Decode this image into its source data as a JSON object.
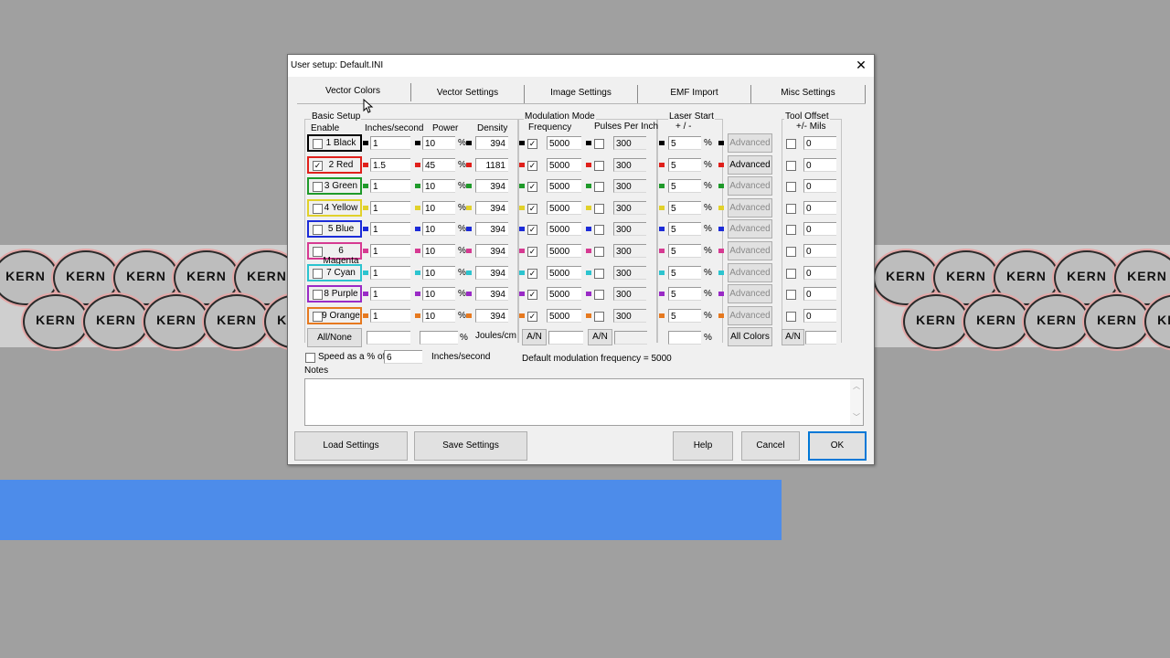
{
  "dialog": {
    "title": "User setup: Default.INI",
    "close_glyph": "✕",
    "tabs": [
      "Vector Colors",
      "Vector Settings",
      "Image Settings",
      "EMF Import",
      "Misc Settings"
    ],
    "active_tab": "Vector Colors"
  },
  "headers": {
    "basic_setup": "Basic Setup",
    "enable": "Enable",
    "speed": "Inches/second",
    "power": "Power",
    "density": "Density",
    "modulation_mode": "Modulation Mode",
    "frequency": "Frequency",
    "pulses_per_inch": "Pulses Per Inch",
    "laser_start": "Laser Start",
    "plus_minus": "+ / -",
    "tool_offset": "Tool Offset",
    "mils": "+/- Mils"
  },
  "rows": [
    {
      "label": "1 Black",
      "color": "#000000",
      "checked": false,
      "speed": "1",
      "power": "10",
      "density": "394",
      "mod": true,
      "freq": "5000",
      "ppi_on": false,
      "ppi": "300",
      "laser": "5",
      "advanced_enabled": false,
      "offset_on": false,
      "offset": "0"
    },
    {
      "label": "2 Red",
      "color": "#e0201b",
      "checked": true,
      "speed": "1.5",
      "power": "45",
      "density": "1181",
      "mod": true,
      "freq": "5000",
      "ppi_on": false,
      "ppi": "300",
      "laser": "5",
      "advanced_enabled": true,
      "offset_on": false,
      "offset": "0"
    },
    {
      "label": "3 Green",
      "color": "#1f9a2a",
      "checked": false,
      "speed": "1",
      "power": "10",
      "density": "394",
      "mod": true,
      "freq": "5000",
      "ppi_on": false,
      "ppi": "300",
      "laser": "5",
      "advanced_enabled": false,
      "offset_on": false,
      "offset": "0"
    },
    {
      "label": "4 Yellow",
      "color": "#e1d12a",
      "checked": false,
      "speed": "1",
      "power": "10",
      "density": "394",
      "mod": true,
      "freq": "5000",
      "ppi_on": false,
      "ppi": "300",
      "laser": "5",
      "advanced_enabled": false,
      "offset_on": false,
      "offset": "0"
    },
    {
      "label": "5 Blue",
      "color": "#1c2bd8",
      "checked": false,
      "speed": "1",
      "power": "10",
      "density": "394",
      "mod": true,
      "freq": "5000",
      "ppi_on": false,
      "ppi": "300",
      "laser": "5",
      "advanced_enabled": false,
      "offset_on": false,
      "offset": "0"
    },
    {
      "label": "6 Magenta",
      "color": "#d63a92",
      "checked": false,
      "speed": "1",
      "power": "10",
      "density": "394",
      "mod": true,
      "freq": "5000",
      "ppi_on": false,
      "ppi": "300",
      "laser": "5",
      "advanced_enabled": false,
      "offset_on": false,
      "offset": "0"
    },
    {
      "label": "7 Cyan",
      "color": "#2cc4cf",
      "checked": false,
      "speed": "1",
      "power": "10",
      "density": "394",
      "mod": true,
      "freq": "5000",
      "ppi_on": false,
      "ppi": "300",
      "laser": "5",
      "advanced_enabled": false,
      "offset_on": false,
      "offset": "0"
    },
    {
      "label": "8 Purple",
      "color": "#9a2bc6",
      "checked": false,
      "speed": "1",
      "power": "10",
      "density": "394",
      "mod": true,
      "freq": "5000",
      "ppi_on": false,
      "ppi": "300",
      "laser": "5",
      "advanced_enabled": false,
      "offset_on": false,
      "offset": "0"
    },
    {
      "label": "9 Orange",
      "color": "#e6791f",
      "checked": false,
      "speed": "1",
      "power": "10",
      "density": "394",
      "mod": true,
      "freq": "5000",
      "ppi_on": false,
      "ppi": "300",
      "laser": "5",
      "advanced_enabled": false,
      "offset_on": false,
      "offset": "0"
    }
  ],
  "advanced_label": "Advanced",
  "percent": "%",
  "bottom_row": {
    "all_none": "All/None",
    "joules": "Joules/cm",
    "an": "A/N",
    "all_colors": "All Colors"
  },
  "speed_pct": {
    "label": "Speed as a % of",
    "value": "6",
    "unit": "Inches/second"
  },
  "default_mod": "Default modulation frequency =  5000",
  "notes_label": "Notes",
  "buttons": {
    "load": "Load Settings",
    "save": "Save Settings",
    "help": "Help",
    "cancel": "Cancel",
    "ok": "OK"
  },
  "background": {
    "logo_text": "KERN"
  }
}
